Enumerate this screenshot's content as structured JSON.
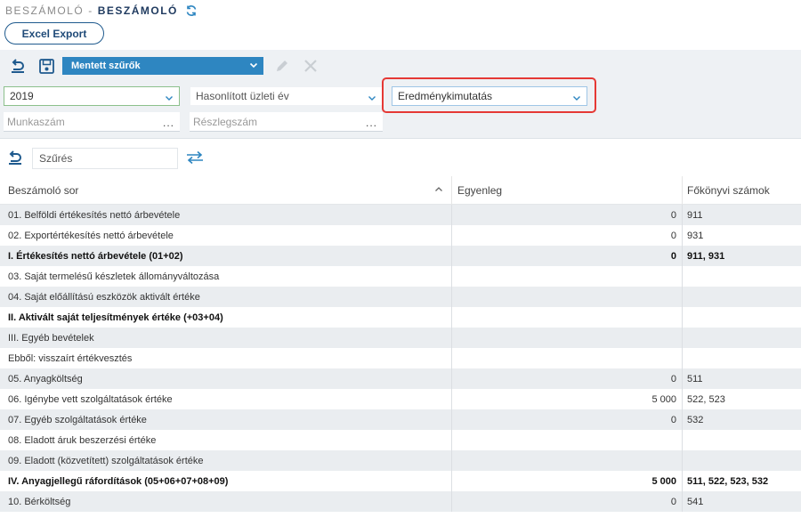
{
  "title": {
    "crumb": "BESZÁMOLÓ",
    "separator": "-",
    "main": "BESZÁMOLÓ"
  },
  "toolbar": {
    "excel_export": "Excel Export",
    "saved_filters": "Mentett szűrők"
  },
  "filters": {
    "year": "2019",
    "compare_year_placeholder": "Hasonlított üzleti év",
    "report_type": "Eredménykimutatás",
    "work_number_placeholder": "Munkaszám",
    "department_placeholder": "Részlegszám",
    "dots": "..."
  },
  "search": {
    "value": "Szűrés"
  },
  "grid": {
    "headers": [
      "Beszámoló sor",
      "Egyenleg",
      "Főkönyvi számok"
    ],
    "rows": [
      {
        "label": "01. Belföldi értékesítés nettó árbevétele",
        "balance": "0",
        "accounts": "911",
        "bold": false
      },
      {
        "label": "02. Exportértékesítés nettó árbevétele",
        "balance": "0",
        "accounts": "931",
        "bold": false
      },
      {
        "label": "I. Értékesítés nettó árbevétele (01+02)",
        "balance": "0",
        "accounts": "911, 931",
        "bold": true
      },
      {
        "label": "03. Saját termelésű készletek állományváltozása",
        "balance": "",
        "accounts": "",
        "bold": false
      },
      {
        "label": "04. Saját előállítású eszközök aktivált értéke",
        "balance": "",
        "accounts": "",
        "bold": false
      },
      {
        "label": "II. Aktivált saját teljesítmények értéke (+03+04)",
        "balance": "",
        "accounts": "",
        "bold": true
      },
      {
        "label": "III. Egyéb bevételek",
        "balance": "",
        "accounts": "",
        "bold": false
      },
      {
        "label": "Ebből: visszaírt értékvesztés",
        "balance": "",
        "accounts": "",
        "bold": false
      },
      {
        "label": "05. Anyagköltség",
        "balance": "0",
        "accounts": "511",
        "bold": false
      },
      {
        "label": "06. Igénybe vett szolgáltatások értéke",
        "balance": "5 000",
        "accounts": "522, 523",
        "bold": false
      },
      {
        "label": "07. Egyéb szolgáltatások értéke",
        "balance": "0",
        "accounts": "532",
        "bold": false
      },
      {
        "label": "08. Eladott áruk beszerzési értéke",
        "balance": "",
        "accounts": "",
        "bold": false
      },
      {
        "label": "09. Eladott (közvetített) szolgáltatások értéke",
        "balance": "",
        "accounts": "",
        "bold": false
      },
      {
        "label": "IV. Anyagjellegű ráfordítások (05+06+07+08+09)",
        "balance": "5 000",
        "accounts": "511, 522, 523, 532",
        "bold": true
      },
      {
        "label": "10. Bérköltség",
        "balance": "0",
        "accounts": "541",
        "bold": false
      }
    ]
  },
  "colors": {
    "accent": "#2e86c1",
    "highlight": "#e53935",
    "title": "#1f3a5f",
    "row_alt": "#eaedf0"
  }
}
